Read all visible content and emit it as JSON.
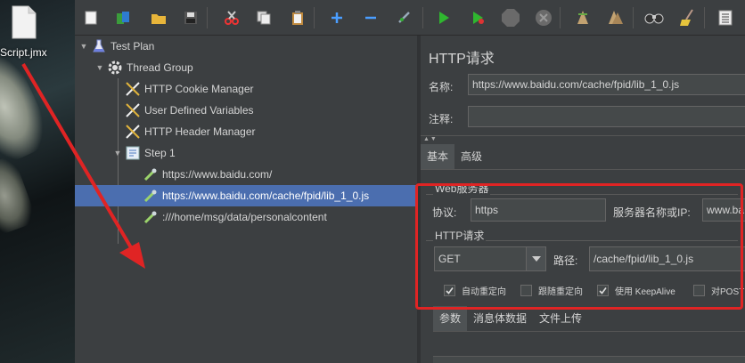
{
  "desktop": {
    "file_label": "Script.jmx"
  },
  "toolbar": {
    "buttons": [
      {
        "name": "new-icon"
      },
      {
        "name": "templates-icon"
      },
      {
        "name": "open-icon"
      },
      {
        "name": "save-icon"
      },
      {
        "name": "cut-icon"
      },
      {
        "name": "copy-icon"
      },
      {
        "name": "paste-icon"
      },
      {
        "name": "expand-icon"
      },
      {
        "name": "collapse-icon"
      },
      {
        "name": "toggle-icon"
      },
      {
        "name": "start-icon"
      },
      {
        "name": "start-no-pause-icon"
      },
      {
        "name": "stop-icon"
      },
      {
        "name": "shutdown-icon"
      },
      {
        "name": "clear-icon"
      },
      {
        "name": "clear-all-icon"
      },
      {
        "name": "search-icon"
      },
      {
        "name": "reset-search-icon"
      },
      {
        "name": "function-helper-icon"
      }
    ]
  },
  "tree": {
    "nodes": [
      {
        "label": "Test Plan",
        "icon": "flask-icon"
      },
      {
        "label": "Thread Group",
        "icon": "gear-icon"
      },
      {
        "label": "HTTP Cookie Manager",
        "icon": "wrench-icon"
      },
      {
        "label": "User Defined Variables",
        "icon": "wrench-icon"
      },
      {
        "label": "HTTP Header Manager",
        "icon": "wrench-icon"
      },
      {
        "label": "Step 1",
        "icon": "controller-icon"
      },
      {
        "label": "https://www.baidu.com/",
        "icon": "pipette-icon"
      },
      {
        "label": "https://www.baidu.com/cache/fpid/lib_1_0.js",
        "icon": "pipette-icon"
      },
      {
        "label": ":///home/msg/data/personalcontent",
        "icon": "pipette-icon"
      }
    ]
  },
  "form": {
    "title": "HTTP请求",
    "name_label": "名称:",
    "name_value": "https://www.baidu.com/cache/fpid/lib_1_0.js",
    "comment_label": "注释:",
    "comment_value": "",
    "collapse_arrows": "▲▼",
    "tabs": [
      "基本",
      "高级"
    ],
    "web_server": {
      "title": "Web服务器",
      "protocol_label": "协议:",
      "protocol_value": "https",
      "server_label": "服务器名称或IP:",
      "server_value": "www.ba"
    },
    "http_request": {
      "title": "HTTP请求",
      "method_value": "GET",
      "path_label": "路径:",
      "path_value": "/cache/fpid/lib_1_0.js"
    },
    "checkboxes": [
      {
        "label": "自动重定向",
        "checked": true
      },
      {
        "label": "跟随重定向",
        "checked": false
      },
      {
        "label": "使用 KeepAlive",
        "checked": true
      },
      {
        "label": "对POST",
        "checked": false
      }
    ],
    "bottom_tabs": [
      "参数",
      "消息体数据",
      "文件上传"
    ]
  },
  "colors": {
    "annotation": "#e02424",
    "selection": "#4b6eaf"
  }
}
